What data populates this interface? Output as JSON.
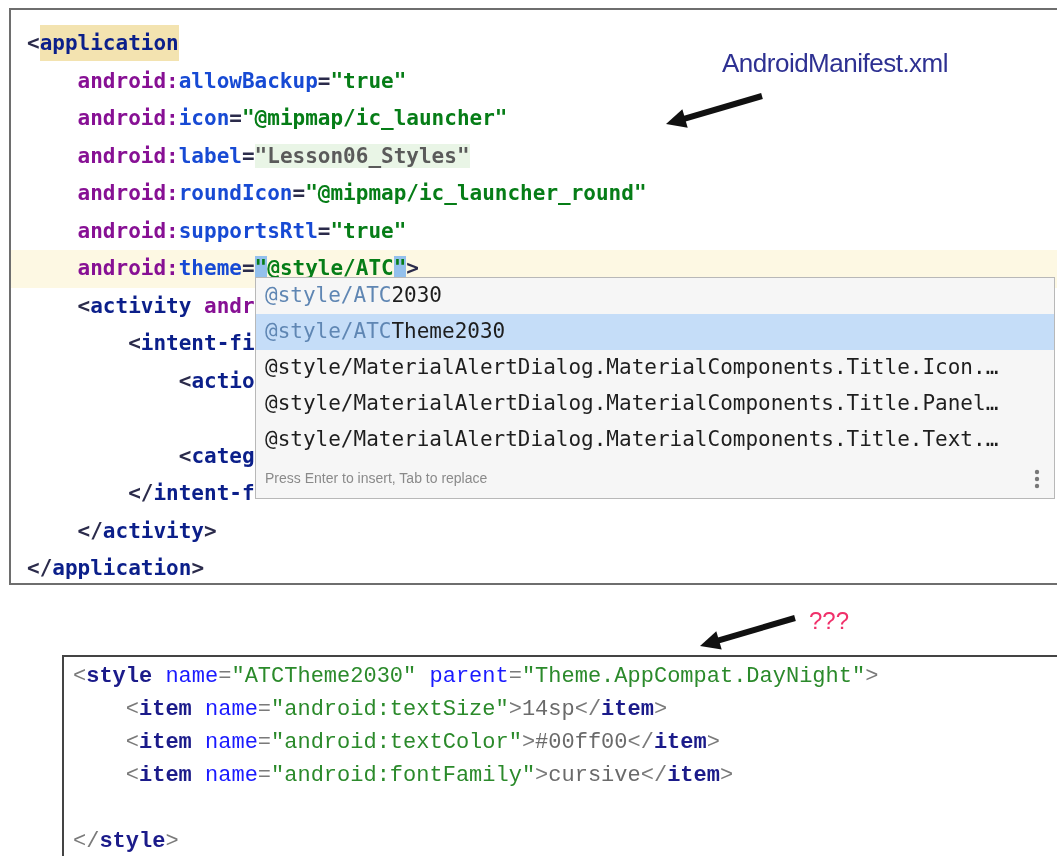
{
  "manifest_editor": {
    "annotation": "AndroidManifest.xml",
    "lines": [
      {
        "current": false,
        "tokens": [
          {
            "kind": "punct",
            "text": "<",
            "highlighted": false
          },
          {
            "kind": "tag",
            "text": "application",
            "highlighted": true
          }
        ]
      },
      {
        "current": false,
        "tokens": [
          {
            "kind": "ns",
            "text": "    android:",
            "highlighted": false
          },
          {
            "kind": "attr",
            "text": "allowBackup",
            "highlighted": false
          },
          {
            "kind": "punct",
            "text": "=",
            "highlighted": false
          },
          {
            "kind": "value",
            "text": "\"true\"",
            "highlighted": false
          }
        ]
      },
      {
        "current": false,
        "tokens": [
          {
            "kind": "ns",
            "text": "    android:",
            "highlighted": false
          },
          {
            "kind": "attr",
            "text": "icon",
            "highlighted": false
          },
          {
            "kind": "punct",
            "text": "=",
            "highlighted": false
          },
          {
            "kind": "value",
            "text": "\"@mipmap/ic_launcher\"",
            "highlighted": false
          }
        ]
      },
      {
        "current": false,
        "tokens": [
          {
            "kind": "ns",
            "text": "    android:",
            "highlighted": false
          },
          {
            "kind": "attr",
            "text": "label",
            "highlighted": false
          },
          {
            "kind": "punct",
            "text": "=",
            "highlighted": false
          },
          {
            "kind": "folded",
            "text": "\"Lesson06_Styles\"",
            "highlighted": true
          }
        ]
      },
      {
        "current": false,
        "tokens": [
          {
            "kind": "ns",
            "text": "    android:",
            "highlighted": false
          },
          {
            "kind": "attr",
            "text": "roundIcon",
            "highlighted": false
          },
          {
            "kind": "punct",
            "text": "=",
            "highlighted": false
          },
          {
            "kind": "value",
            "text": "\"@mipmap/ic_launcher_round\"",
            "highlighted": false
          }
        ]
      },
      {
        "current": false,
        "tokens": [
          {
            "kind": "ns",
            "text": "    android:",
            "highlighted": false
          },
          {
            "kind": "attr",
            "text": "supportsRtl",
            "highlighted": false
          },
          {
            "kind": "punct",
            "text": "=",
            "highlighted": false
          },
          {
            "kind": "value",
            "text": "\"true\"",
            "highlighted": false
          }
        ]
      },
      {
        "current": true,
        "tokens": [
          {
            "kind": "ns",
            "text": "    android:",
            "highlighted": false
          },
          {
            "kind": "attr",
            "text": "theme",
            "highlighted": false
          },
          {
            "kind": "punct",
            "text": "=",
            "highlighted": false
          },
          {
            "kind": "brace",
            "text": "\"",
            "highlighted": true
          },
          {
            "kind": "value",
            "text": "@style/ATC",
            "highlighted": false
          },
          {
            "kind": "brace",
            "text": "\"",
            "highlighted": true
          },
          {
            "kind": "punct",
            "text": ">",
            "highlighted": false
          }
        ]
      },
      {
        "current": false,
        "tokens": [
          {
            "kind": "punct",
            "text": "    <",
            "highlighted": false
          },
          {
            "kind": "tag",
            "text": "activity",
            "highlighted": false
          },
          {
            "kind": "ns",
            "text": " andr",
            "highlighted": false
          }
        ]
      },
      {
        "current": false,
        "tokens": [
          {
            "kind": "punct",
            "text": "        <",
            "highlighted": false
          },
          {
            "kind": "tag",
            "text": "intent-fi",
            "highlighted": false
          }
        ]
      },
      {
        "current": false,
        "tokens": [
          {
            "kind": "punct",
            "text": "            <",
            "highlighted": false
          },
          {
            "kind": "tag",
            "text": "actio",
            "highlighted": false
          }
        ]
      },
      {
        "current": false,
        "gap_before": true,
        "tokens": [
          {
            "kind": "punct",
            "text": "            <",
            "highlighted": false
          },
          {
            "kind": "tag",
            "text": "categ",
            "highlighted": false
          }
        ]
      },
      {
        "current": false,
        "tokens": [
          {
            "kind": "punct",
            "text": "        </",
            "highlighted": false
          },
          {
            "kind": "tag",
            "text": "intent-f",
            "highlighted": false
          }
        ]
      },
      {
        "current": false,
        "tokens": [
          {
            "kind": "punct",
            "text": "    </",
            "highlighted": false
          },
          {
            "kind": "tag",
            "text": "activity",
            "highlighted": false
          },
          {
            "kind": "punct",
            "text": ">",
            "highlighted": false
          }
        ]
      },
      {
        "current": false,
        "tokens": [
          {
            "kind": "punct",
            "text": "</",
            "highlighted": false
          },
          {
            "kind": "tag",
            "text": "application",
            "highlighted": false
          },
          {
            "kind": "punct",
            "text": ">",
            "highlighted": false
          }
        ]
      }
    ],
    "completion_popup": {
      "items": [
        {
          "match": "@style/ATC",
          "rest": "2030",
          "selected": false
        },
        {
          "match": "@style/ATC",
          "rest": "Theme2030",
          "selected": true
        },
        {
          "rest": "@style/MaterialAlertDialog.MaterialComponents.Title.Icon.…",
          "selected": false
        },
        {
          "rest": "@style/MaterialAlertDialog.MaterialComponents.Title.Panel…",
          "selected": false
        },
        {
          "rest": "@style/MaterialAlertDialog.MaterialComponents.Title.Text.…",
          "selected": false
        }
      ],
      "hint": "Press Enter to insert, Tab to replace"
    }
  },
  "styles_snippet": {
    "annotation": "???",
    "lines": [
      {
        "tokens": [
          {
            "kind": "punct",
            "text": "<"
          },
          {
            "kind": "tag",
            "text": "style"
          },
          {
            "kind": "attr",
            "text": " name"
          },
          {
            "kind": "punct",
            "text": "="
          },
          {
            "kind": "value",
            "text": "\"ATCTheme2030\""
          },
          {
            "kind": "attr",
            "text": " parent"
          },
          {
            "kind": "punct",
            "text": "="
          },
          {
            "kind": "value",
            "text": "\"Theme.AppCompat.DayNight\""
          },
          {
            "kind": "punct",
            "text": ">"
          }
        ]
      },
      {
        "tokens": [
          {
            "kind": "punct",
            "text": "    <"
          },
          {
            "kind": "tag",
            "text": "item"
          },
          {
            "kind": "attr",
            "text": " name"
          },
          {
            "kind": "punct",
            "text": "="
          },
          {
            "kind": "value",
            "text": "\"android:textSize\""
          },
          {
            "kind": "punct",
            "text": ">"
          },
          {
            "kind": "text",
            "text": "14sp"
          },
          {
            "kind": "punct",
            "text": "</"
          },
          {
            "kind": "tag",
            "text": "item"
          },
          {
            "kind": "punct",
            "text": ">"
          }
        ]
      },
      {
        "tokens": [
          {
            "kind": "punct",
            "text": "    <"
          },
          {
            "kind": "tag",
            "text": "item"
          },
          {
            "kind": "attr",
            "text": " name"
          },
          {
            "kind": "punct",
            "text": "="
          },
          {
            "kind": "value",
            "text": "\"android:textColor\""
          },
          {
            "kind": "punct",
            "text": ">"
          },
          {
            "kind": "text",
            "text": "#00ff00"
          },
          {
            "kind": "punct",
            "text": "</"
          },
          {
            "kind": "tag",
            "text": "item"
          },
          {
            "kind": "punct",
            "text": ">"
          }
        ]
      },
      {
        "tokens": [
          {
            "kind": "punct",
            "text": "    <"
          },
          {
            "kind": "tag",
            "text": "item"
          },
          {
            "kind": "attr",
            "text": " name"
          },
          {
            "kind": "punct",
            "text": "="
          },
          {
            "kind": "value",
            "text": "\"android:fontFamily\""
          },
          {
            "kind": "punct",
            "text": ">"
          },
          {
            "kind": "text",
            "text": "cursive"
          },
          {
            "kind": "punct",
            "text": "</"
          },
          {
            "kind": "tag",
            "text": "item"
          },
          {
            "kind": "punct",
            "text": ">"
          }
        ]
      },
      {
        "gap_before": true,
        "tokens": [
          {
            "kind": "punct",
            "text": "</"
          },
          {
            "kind": "tag",
            "text": "style"
          },
          {
            "kind": "punct",
            "text": ">"
          }
        ]
      }
    ]
  }
}
